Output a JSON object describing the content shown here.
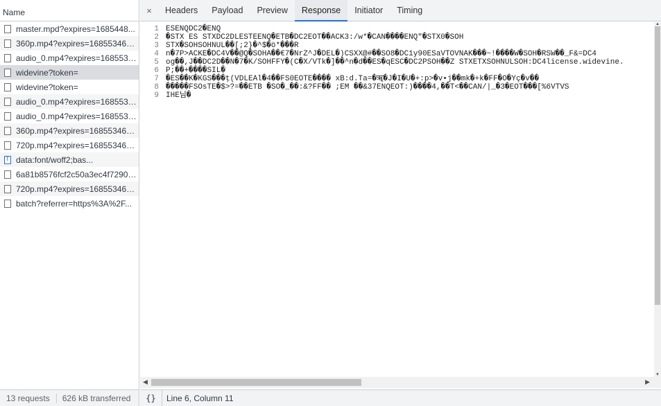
{
  "requests": {
    "header": "Name",
    "items": [
      {
        "name": "master.mpd?expires=1685448...",
        "icon": "document-icon"
      },
      {
        "name": "360p.mp4?expires=168553467...",
        "icon": "document-icon"
      },
      {
        "name": "audio_0.mp4?expires=1685534...",
        "icon": "document-icon"
      },
      {
        "name": "widevine?token=",
        "icon": "document-icon"
      },
      {
        "name": "widevine?token=",
        "icon": "document-icon"
      },
      {
        "name": "audio_0.mp4?expires=1685534...",
        "icon": "document-icon"
      },
      {
        "name": "audio_0.mp4?expires=1685534...",
        "icon": "document-icon"
      },
      {
        "name": "360p.mp4?expires=168553467...",
        "icon": "document-icon"
      },
      {
        "name": "720p.mp4?expires=168553467...",
        "icon": "document-icon"
      },
      {
        "name": "data:font/woff2;bas...",
        "icon": "font-icon"
      },
      {
        "name": "6a81b8576fcf2c50a3ec4f72901...",
        "icon": "document-icon"
      },
      {
        "name": "720p.mp4?expires=168553467...",
        "icon": "document-icon"
      },
      {
        "name": "batch?referrer=https%3A%2F...",
        "icon": "document-icon"
      }
    ],
    "status": {
      "count": "13 requests",
      "transferred": "626 kB transferred"
    }
  },
  "tabs": {
    "close": "×",
    "items": [
      "Headers",
      "Payload",
      "Preview",
      "Response",
      "Initiator",
      "Timing"
    ],
    "active": "Response"
  },
  "response": {
    "lines": [
      {
        "n": "1",
        "text": "ESENQDC2�ENQ"
      },
      {
        "n": "2",
        "text": "�STX ES STXDC2DLESTEENQ�ETB�DC2EOT��ACK3:/w*�CAN����ENQ\"�STX0�SOH"
      },
      {
        "n": "3",
        "text": "STX�SOHSOHNUL��[;2}�^$�ö*���R"
      },
      {
        "n": "4",
        "text": "n�7P>ACKE�DC4V��@Q�SOHA��€7�NrZ^J�DEL�)CSXX@#��SO8�DC1y90ESaVTOVNAK���~!����W�SOH�RSW��_F&=DC4"
      },
      {
        "n": "5",
        "text": "og��,J��DC2D��N�7�K/SOHFFY�(C�X/VTk�]��^n�d��ES�qESC�DC2PSOH��Z   STXETXSOHNULSOH:DC4license.widevine."
      },
      {
        "n": "6",
        "text": "P;��+����SIL�"
      },
      {
        "n": "7",
        "text": "�ES��K�KGS���ţ(VDLEAl�4��FS0EOTE����    xB:d.Ta=�ॠ�J�I�U�+:p>�v•j��mk�+k�FF�O�Yç�v��"
      },
      {
        "n": "8",
        "text": "�����FSOsTE�$>?=��ETB  �SO�_��:&?FF��  ;EM  ��&37ENQEOT:)����4,��T<��CAN/|_�3�EOT���[%6VTVS"
      },
      {
        "n": "9",
        "text": "IHE님�"
      }
    ]
  },
  "footer": {
    "pretty_print": "{}",
    "cursor": "Line 6, Column 11"
  },
  "scrollbars": {
    "up_arrow": "▲",
    "down_arrow": "▼",
    "left_arrow": "◀",
    "right_arrow": "▶"
  }
}
